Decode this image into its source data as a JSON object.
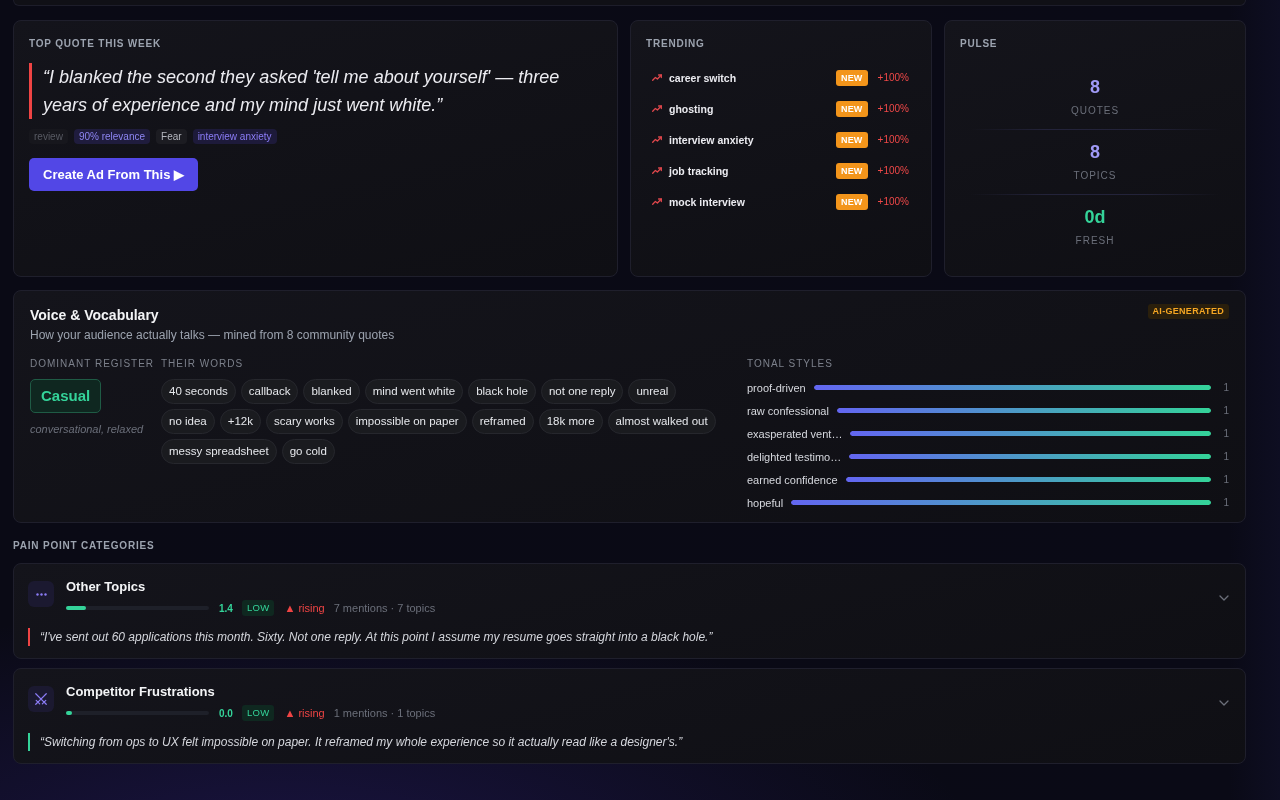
{
  "top_quote": {
    "title": "TOP QUOTE THIS WEEK",
    "quote": "“I blanked the second they asked 'tell me about yourself' — three years of experience and my mind just went white.”",
    "tags": [
      {
        "label": "review",
        "kind": "source"
      },
      {
        "label": "90% relevance",
        "kind": "score"
      },
      {
        "label": "Fear",
        "kind": "emotion"
      },
      {
        "label": "interview anxiety",
        "kind": "topic"
      }
    ],
    "button": "Create Ad From This ▶"
  },
  "trending": {
    "title": "TRENDING",
    "items": [
      {
        "label": "career switch",
        "badge": "NEW",
        "change": "+100%"
      },
      {
        "label": "ghosting",
        "badge": "NEW",
        "change": "+100%"
      },
      {
        "label": "interview anxiety",
        "badge": "NEW",
        "change": "+100%"
      },
      {
        "label": "job tracking",
        "badge": "NEW",
        "change": "+100%"
      },
      {
        "label": "mock interview",
        "badge": "NEW",
        "change": "+100%"
      }
    ]
  },
  "pulse": {
    "title": "PULSE",
    "stats": [
      {
        "value": "8",
        "label": "QUOTES",
        "color": "#a09af7"
      },
      {
        "value": "8",
        "label": "TOPICS",
        "color": "#a09af7"
      },
      {
        "value": "0d",
        "label": "FRESH",
        "color": "#34d399"
      }
    ]
  },
  "voice": {
    "title": "Voice & Vocabulary",
    "subtitle": "How your audience actually talks — mined from 8 community quotes",
    "badge": "AI-GENERATED",
    "register": {
      "heading": "DOMINANT REGISTER",
      "value": "Casual",
      "note": "conversational, relaxed"
    },
    "words": {
      "heading": "THEIR WORDS",
      "items": [
        "40 seconds",
        "callback",
        "blanked",
        "mind went white",
        "black hole",
        "not one reply",
        "unreal",
        "no idea",
        "+12k",
        "scary works",
        "impossible on paper",
        "reframed",
        "18k more",
        "almost walked out",
        "messy spreadsheet",
        "go cold"
      ]
    },
    "tones": {
      "heading": "TONAL STYLES",
      "items": [
        {
          "label": "proof-driven",
          "level": 1,
          "count": "1"
        },
        {
          "label": "raw confessional",
          "level": 1,
          "count": "1"
        },
        {
          "label": "exasperated vent…",
          "level": 1,
          "count": "1"
        },
        {
          "label": "delighted testimo…",
          "level": 1,
          "count": "1"
        },
        {
          "label": "earned confidence",
          "level": 1,
          "count": "1"
        },
        {
          "label": "hopeful",
          "level": 1,
          "count": "1"
        }
      ]
    }
  },
  "pain_points": {
    "title": "PAIN POINT CATEGORIES",
    "categories": [
      {
        "kind": "other",
        "title": "Other Topics",
        "level": 0.14,
        "score": "1.4",
        "severity": "LOW",
        "trend": "▲ rising",
        "stats": "7 mentions · 7 topics",
        "expanded": false,
        "quote": {
          "text": "“I've sent out 60 applications this month. Sixty. Not one reply. At this point I assume my resume goes straight into a black hole.”",
          "color": "#ef4444"
        }
      },
      {
        "kind": "competitor",
        "title": "Competitor Frustrations",
        "level": 0.0,
        "score": "0.0",
        "severity": "LOW",
        "trend": "▲ rising",
        "stats": "1 mentions · 1 topics",
        "expanded": false,
        "quote": {
          "text": "“Switching from ops to UX felt impossible on paper. It reframed my whole experience so it actually read like a designer's.”",
          "color": "#34d399"
        }
      }
    ]
  }
}
